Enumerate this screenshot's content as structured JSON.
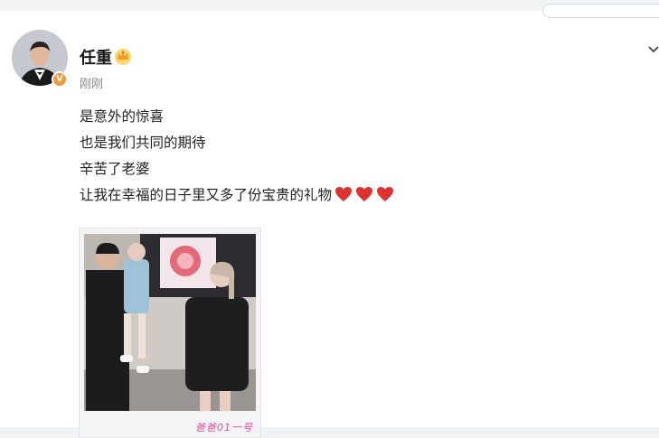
{
  "post": {
    "author": "任重",
    "timestamp": "刚刚",
    "verified_badge": "V",
    "crown_icon": "crown-icon",
    "lines": [
      "是意外的惊喜",
      "也是我们共同的期待",
      "辛苦了老婆",
      "让我在幸福的日子里又多了份宝贵的礼物"
    ],
    "heart_count": 3,
    "heart_color": "#e0312f",
    "photo_caption": "爸爸01一号"
  },
  "colors": {
    "badge": "#f29a38",
    "text": "#222222",
    "muted": "#8a8a8a"
  }
}
